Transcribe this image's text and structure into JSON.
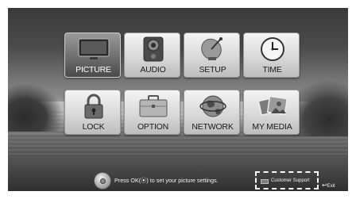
{
  "menu": {
    "tiles": [
      {
        "id": "picture",
        "label": "PICTURE",
        "icon": "tv-icon",
        "selected": true
      },
      {
        "id": "audio",
        "label": "AUDIO",
        "icon": "speaker-icon",
        "selected": false
      },
      {
        "id": "setup",
        "label": "SETUP",
        "icon": "satellite-dish-icon",
        "selected": false
      },
      {
        "id": "time",
        "label": "TIME",
        "icon": "clock-icon",
        "selected": false
      },
      {
        "id": "lock",
        "label": "LOCK",
        "icon": "padlock-icon",
        "selected": false
      },
      {
        "id": "option",
        "label": "OPTION",
        "icon": "briefcase-icon",
        "selected": false
      },
      {
        "id": "network",
        "label": "NETWORK",
        "icon": "globe-icon",
        "selected": false
      },
      {
        "id": "my_media",
        "label": "MY MEDIA",
        "icon": "photos-icon",
        "selected": false
      }
    ]
  },
  "bottom_bar": {
    "hint_prefix": "Press OK(",
    "hint_ok_glyph": "⦿",
    "hint_suffix": ") to set your picture settings.",
    "support_label": "Customer Support",
    "exit_glyph": "↩",
    "exit_label": "Exit"
  },
  "colors": {
    "tile_light": "#d9d9d9",
    "tile_selected": "#6a6a6a",
    "text_light": "#f2f2f2"
  }
}
